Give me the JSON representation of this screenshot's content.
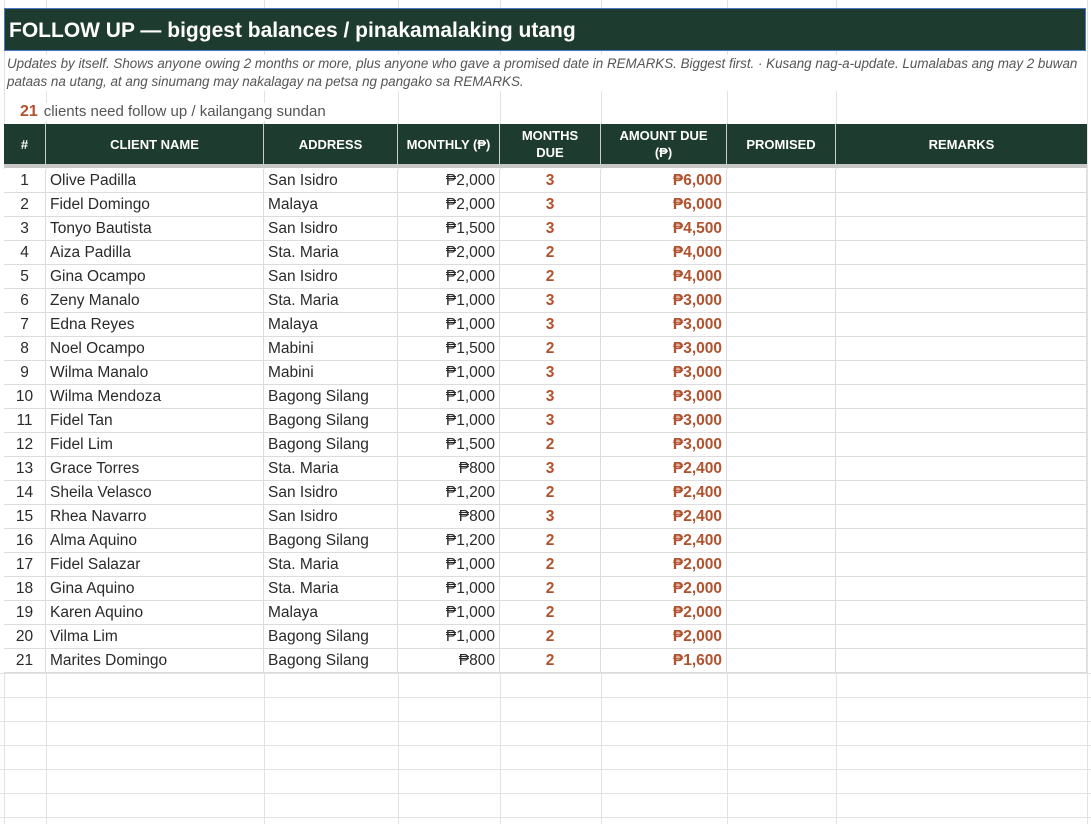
{
  "title": "FOLLOW UP — biggest balances  /  pinakamalaking utang",
  "subtitle": "Updates by itself. Shows anyone owing 2 months or more, plus anyone who gave a promised date in REMARKS. Biggest first.  ·  Kusang nag-a-update. Lumalabas ang may 2 buwan pataas na utang, at ang sinumang may nakalagay na petsa ng pangako sa REMARKS.",
  "count": {
    "value": "21",
    "label": "clients need follow up  /  kailangang sundan"
  },
  "colors": {
    "header_bg": "#1e3b2f",
    "accent": "#b2512d"
  },
  "table": {
    "headers": [
      "#",
      "CLIENT NAME",
      "ADDRESS",
      "MONTHLY (₱)",
      "MONTHS DUE",
      "AMOUNT DUE (₱)",
      "PROMISED",
      "REMARKS"
    ],
    "rows": [
      {
        "num": "1",
        "name": "Olive Padilla",
        "address": "San Isidro",
        "monthly": "₱2,000",
        "months": "3",
        "amount": "₱6,000",
        "promised": "",
        "remarks": ""
      },
      {
        "num": "2",
        "name": "Fidel Domingo",
        "address": "Malaya",
        "monthly": "₱2,000",
        "months": "3",
        "amount": "₱6,000",
        "promised": "",
        "remarks": ""
      },
      {
        "num": "3",
        "name": "Tonyo Bautista",
        "address": "San Isidro",
        "monthly": "₱1,500",
        "months": "3",
        "amount": "₱4,500",
        "promised": "",
        "remarks": ""
      },
      {
        "num": "4",
        "name": "Aiza Padilla",
        "address": "Sta. Maria",
        "monthly": "₱2,000",
        "months": "2",
        "amount": "₱4,000",
        "promised": "",
        "remarks": ""
      },
      {
        "num": "5",
        "name": "Gina Ocampo",
        "address": "San Isidro",
        "monthly": "₱2,000",
        "months": "2",
        "amount": "₱4,000",
        "promised": "",
        "remarks": ""
      },
      {
        "num": "6",
        "name": "Zeny Manalo",
        "address": "Sta. Maria",
        "monthly": "₱1,000",
        "months": "3",
        "amount": "₱3,000",
        "promised": "",
        "remarks": ""
      },
      {
        "num": "7",
        "name": "Edna Reyes",
        "address": "Malaya",
        "monthly": "₱1,000",
        "months": "3",
        "amount": "₱3,000",
        "promised": "",
        "remarks": ""
      },
      {
        "num": "8",
        "name": "Noel Ocampo",
        "address": "Mabini",
        "monthly": "₱1,500",
        "months": "2",
        "amount": "₱3,000",
        "promised": "",
        "remarks": ""
      },
      {
        "num": "9",
        "name": "Wilma Manalo",
        "address": "Mabini",
        "monthly": "₱1,000",
        "months": "3",
        "amount": "₱3,000",
        "promised": "",
        "remarks": ""
      },
      {
        "num": "10",
        "name": "Wilma Mendoza",
        "address": "Bagong Silang",
        "monthly": "₱1,000",
        "months": "3",
        "amount": "₱3,000",
        "promised": "",
        "remarks": ""
      },
      {
        "num": "11",
        "name": "Fidel Tan",
        "address": "Bagong Silang",
        "monthly": "₱1,000",
        "months": "3",
        "amount": "₱3,000",
        "promised": "",
        "remarks": ""
      },
      {
        "num": "12",
        "name": "Fidel Lim",
        "address": "Bagong Silang",
        "monthly": "₱1,500",
        "months": "2",
        "amount": "₱3,000",
        "promised": "",
        "remarks": ""
      },
      {
        "num": "13",
        "name": "Grace Torres",
        "address": "Sta. Maria",
        "monthly": "₱800",
        "months": "3",
        "amount": "₱2,400",
        "promised": "",
        "remarks": ""
      },
      {
        "num": "14",
        "name": "Sheila Velasco",
        "address": "San Isidro",
        "monthly": "₱1,200",
        "months": "2",
        "amount": "₱2,400",
        "promised": "",
        "remarks": ""
      },
      {
        "num": "15",
        "name": "Rhea Navarro",
        "address": "San Isidro",
        "monthly": "₱800",
        "months": "3",
        "amount": "₱2,400",
        "promised": "",
        "remarks": ""
      },
      {
        "num": "16",
        "name": "Alma Aquino",
        "address": "Bagong Silang",
        "monthly": "₱1,200",
        "months": "2",
        "amount": "₱2,400",
        "promised": "",
        "remarks": ""
      },
      {
        "num": "17",
        "name": "Fidel Salazar",
        "address": "Sta. Maria",
        "monthly": "₱1,000",
        "months": "2",
        "amount": "₱2,000",
        "promised": "",
        "remarks": ""
      },
      {
        "num": "18",
        "name": "Gina Aquino",
        "address": "Sta. Maria",
        "monthly": "₱1,000",
        "months": "2",
        "amount": "₱2,000",
        "promised": "",
        "remarks": ""
      },
      {
        "num": "19",
        "name": "Karen Aquino",
        "address": "Malaya",
        "monthly": "₱1,000",
        "months": "2",
        "amount": "₱2,000",
        "promised": "",
        "remarks": ""
      },
      {
        "num": "20",
        "name": "Vilma Lim",
        "address": "Bagong Silang",
        "monthly": "₱1,000",
        "months": "2",
        "amount": "₱2,000",
        "promised": "",
        "remarks": ""
      },
      {
        "num": "21",
        "name": "Marites Domingo",
        "address": "Bagong Silang",
        "monthly": "₱800",
        "months": "2",
        "amount": "₱1,600",
        "promised": "",
        "remarks": ""
      }
    ]
  }
}
